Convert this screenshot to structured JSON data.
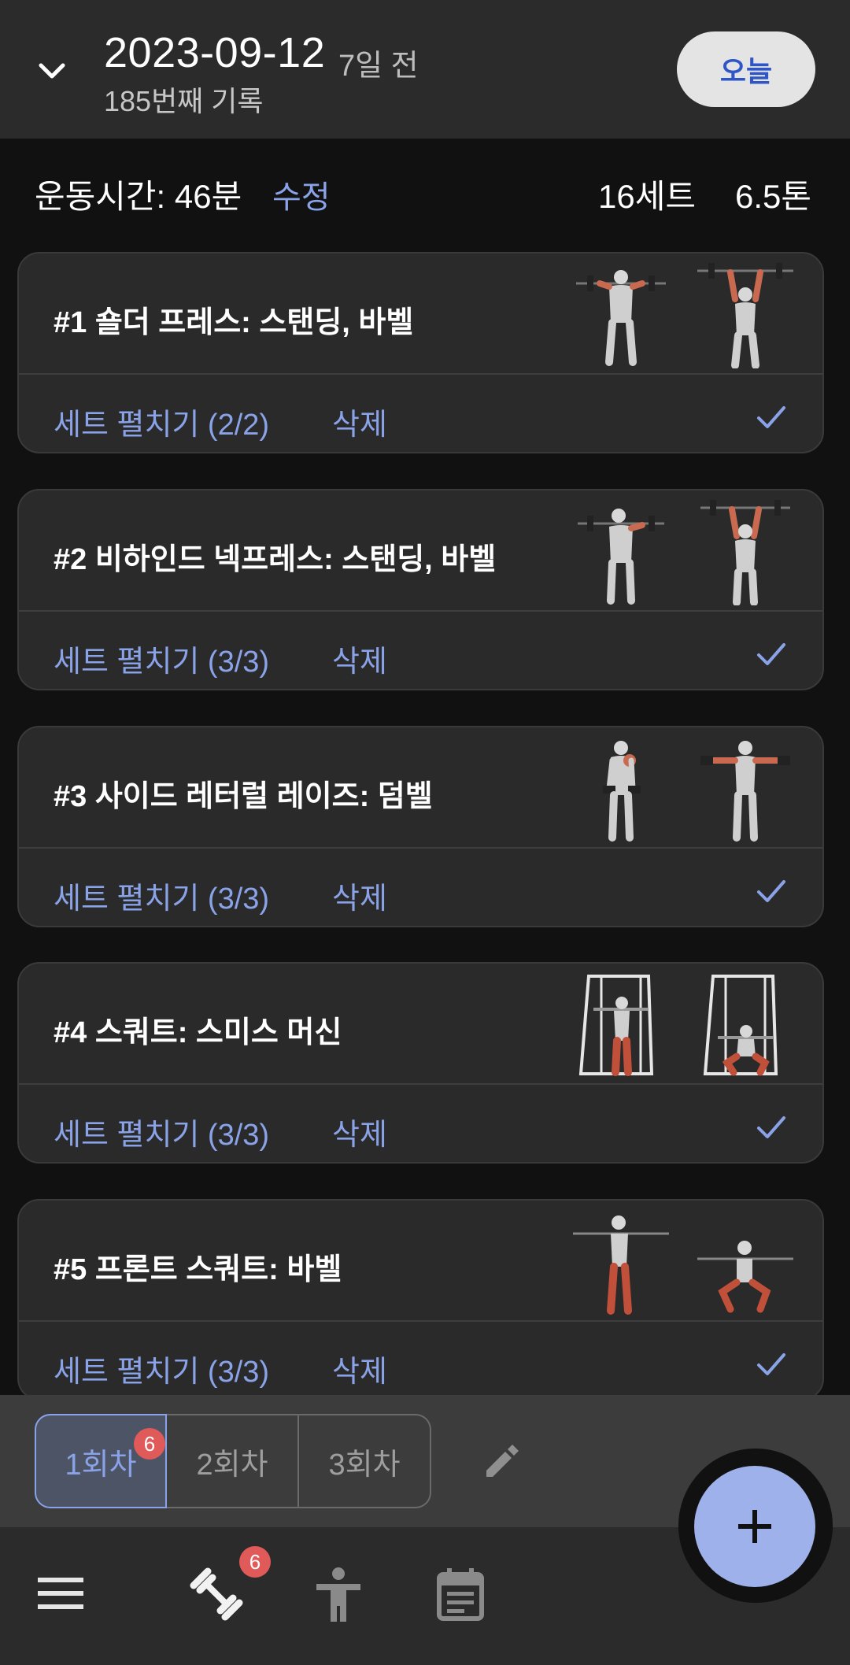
{
  "header": {
    "date": "2023-09-12",
    "ago": "7일 전",
    "record_count": "185번째 기록",
    "today_button": "오늘"
  },
  "summary": {
    "duration": "운동시간: 46분",
    "edit": "수정",
    "sets": "16세트",
    "tons": "6.5톤"
  },
  "exercises": [
    {
      "title": "#1 숄더 프레스: 스탠딩, 바벨",
      "expand": "세트 펼치기 (2/2)",
      "delete": "삭제"
    },
    {
      "title": "#2 비하인드 넥프레스: 스탠딩, 바벨",
      "expand": "세트 펼치기 (3/3)",
      "delete": "삭제"
    },
    {
      "title": "#3 사이드 레터럴 레이즈: 덤벨",
      "expand": "세트 펼치기 (3/3)",
      "delete": "삭제"
    },
    {
      "title": "#4 스쿼트: 스미스 머신",
      "expand": "세트 펼치기 (3/3)",
      "delete": "삭제"
    },
    {
      "title": "#5 프론트 스쿼트: 바벨",
      "expand": "세트 펼치기 (3/3)",
      "delete": "삭제"
    }
  ],
  "sessions": {
    "tabs": [
      "1회차",
      "2회차",
      "3회차"
    ],
    "active_badge": "6"
  },
  "nav": {
    "workout_badge": "6",
    "icons": [
      "menu-icon",
      "dumbbell-icon",
      "body-icon",
      "calendar-icon"
    ]
  },
  "colors": {
    "accent": "#8aa3e8",
    "fab": "#9eb1ea",
    "badge": "#e05a5a",
    "card": "#2a2a2a",
    "background": "#111111"
  }
}
